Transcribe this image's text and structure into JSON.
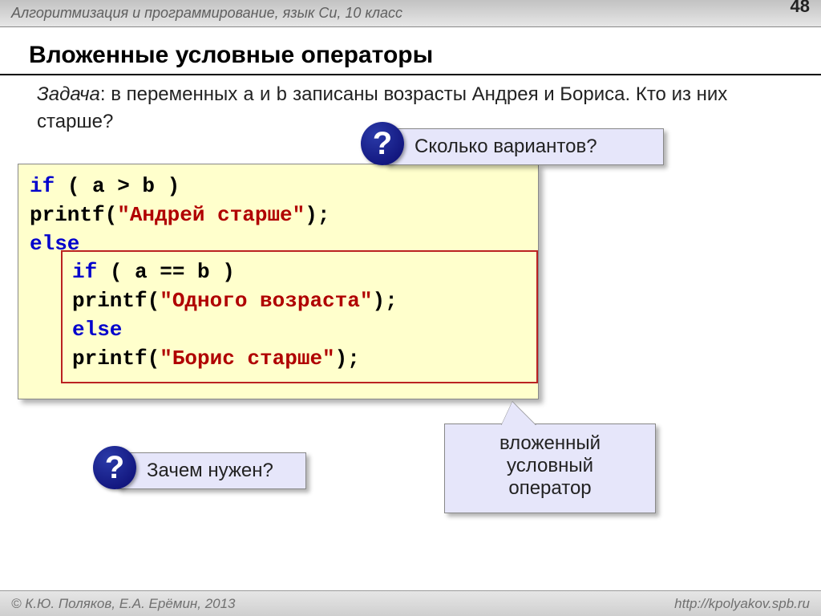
{
  "header": {
    "course": "Алгоритмизация и программирование, язык Си, 10 класс",
    "page": "48"
  },
  "title": "Вложенные условные операторы",
  "task": {
    "label": "Задача",
    "text_before": ": в переменных ",
    "var_a": "a",
    "mid": " и ",
    "var_b": "b",
    "text_after": " записаны возрасты Андрея и Бориса. Кто из них старше?"
  },
  "question1": {
    "mark": "?",
    "text": "Сколько вариантов?"
  },
  "question2": {
    "mark": "?",
    "text": "Зачем нужен?"
  },
  "callout": {
    "line1": "вложенный",
    "line2": "условный",
    "line3": "оператор"
  },
  "code_outer": {
    "l1_if": "if",
    "l1_cond": " ( a > b )",
    "l2_printf": "  printf(",
    "l2_str": "\"Андрей старше\"",
    "l2_tail": ");",
    "l3_else": "else"
  },
  "code_inner": {
    "l1_if": "if",
    "l1_cond": " ( a == b )",
    "l2_printf": "  printf(",
    "l2_str": "\"Одного возраста\"",
    "l2_tail": ");",
    "l3_else": "else",
    "l4_printf": "  printf(",
    "l4_str": "\"Борис старше\"",
    "l4_tail": ");"
  },
  "footer": {
    "left": "© К.Ю. Поляков, Е.А. Ерёмин, 2013",
    "right": "http://kpolyakov.spb.ru"
  }
}
